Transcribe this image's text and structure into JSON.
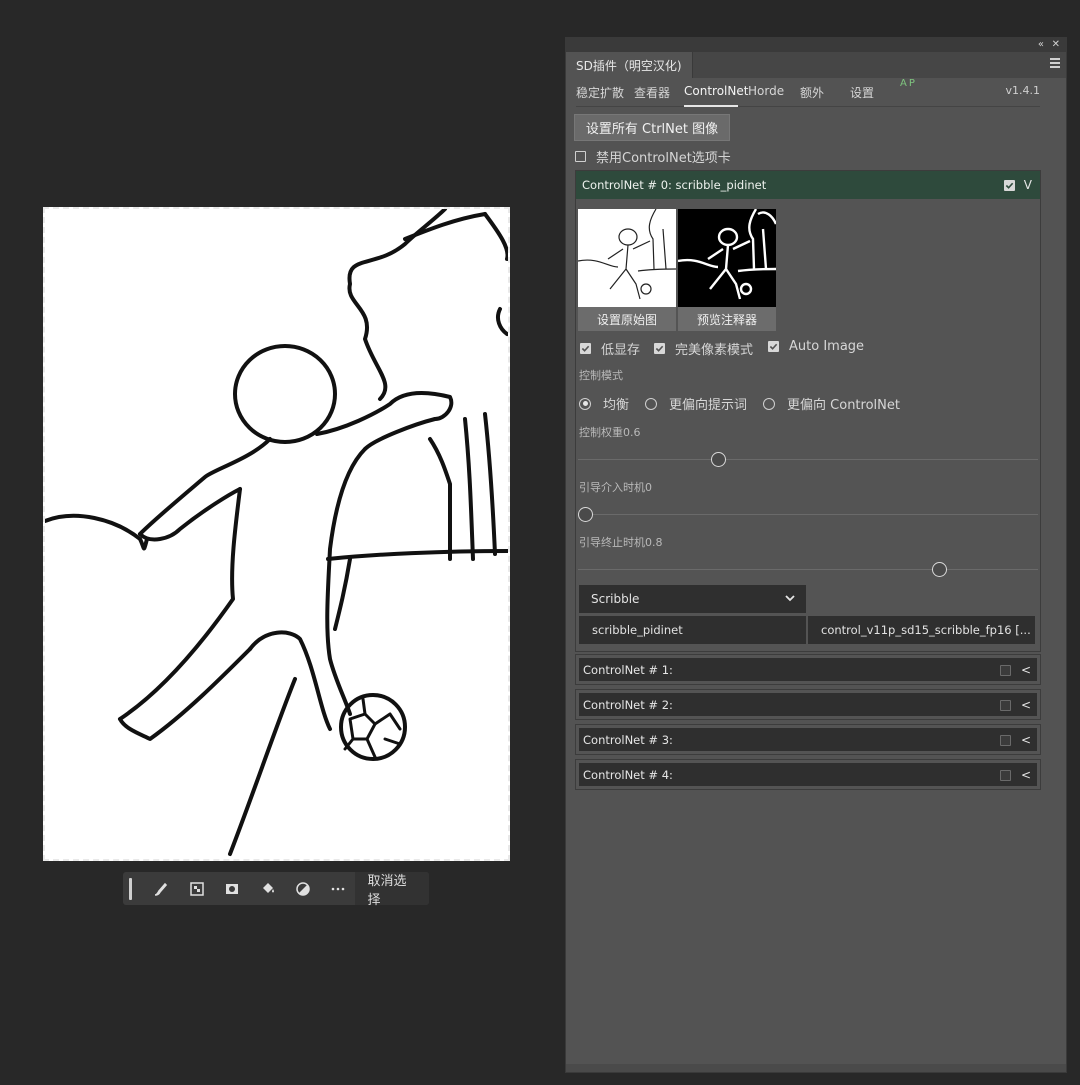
{
  "panel": {
    "tab_title": "SD插件（明空汉化)",
    "collapse_icon": "double-chevron-left-icon",
    "close_icon": "close-icon",
    "menu_icon": "hamburger-menu-icon"
  },
  "nav": {
    "tabs": [
      "稳定扩散",
      "查看器",
      "ControlNet",
      "Horde",
      "额外",
      "设置"
    ],
    "active": "ControlNet",
    "ap_label": "AP",
    "version": "v1.4.1"
  },
  "controlnet": {
    "set_all_button": "设置所有 CtrlNet 图像",
    "disable_tab_label": "禁用ControlNet选项卡",
    "disable_tab_checked": false,
    "units": [
      {
        "title": "ControlNet # 0: scribble_pidinet",
        "enabled": true,
        "expanded": true,
        "set_source_button": "设置原始图",
        "preview_annotator_button": "预览注释器",
        "options": [
          {
            "label": "低显存",
            "checked": true
          },
          {
            "label": "完美像素模式",
            "checked": true
          },
          {
            "label": "Auto Image",
            "checked": true
          }
        ],
        "control_mode_label": "控制模式",
        "control_modes": [
          {
            "label": "均衡",
            "selected": true
          },
          {
            "label": "更偏向提示词",
            "selected": false
          },
          {
            "label": "更偏向 ControlNet",
            "selected": false
          }
        ],
        "weight_label": "控制权重0.6",
        "weight": 0.6,
        "guidance_start_label": "引导介入时机0",
        "guidance_start": 0,
        "guidance_end_label": "引导终止时机0.8",
        "guidance_end": 0.8,
        "preprocessor_type": "Scribble",
        "preprocessor": "scribble_pidinet",
        "model": "control_v11p_sd15_scribble_fp16 [..."
      },
      {
        "title": "ControlNet # 1:",
        "enabled": false,
        "expanded": false
      },
      {
        "title": "ControlNet # 2:",
        "enabled": false,
        "expanded": false
      },
      {
        "title": "ControlNet # 3:",
        "enabled": false,
        "expanded": false
      },
      {
        "title": "ControlNet # 4:",
        "enabled": false,
        "expanded": false
      }
    ]
  },
  "context_bar": {
    "tools": [
      "brush-icon",
      "mask-checker-icon",
      "layer-mask-icon",
      "fill-bucket-icon",
      "adjustment-circle-icon",
      "more-icon"
    ],
    "deselect_label": "取消选择"
  }
}
